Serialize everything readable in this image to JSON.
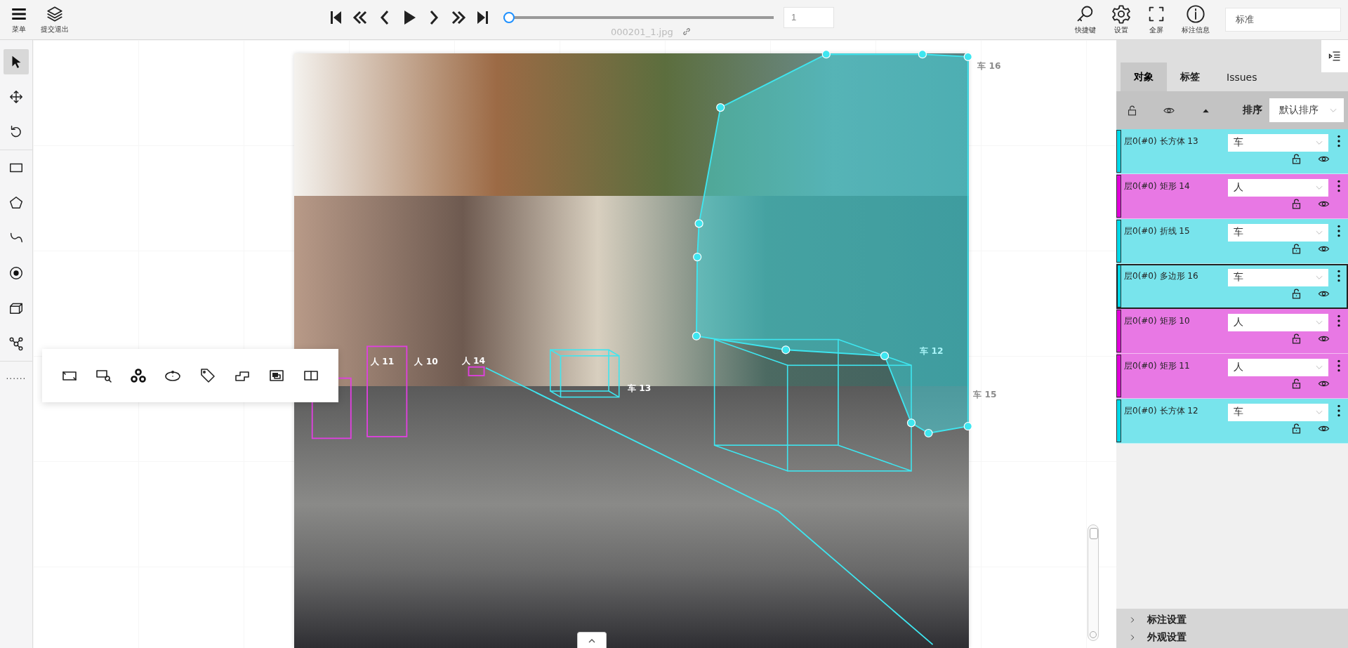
{
  "toolbar": {
    "left_buttons": [
      {
        "kind": "menu",
        "label": "菜单"
      },
      {
        "kind": "submit",
        "label": "提交退出"
      }
    ],
    "playback": [
      {
        "kind": "first"
      },
      {
        "kind": "fast-back"
      },
      {
        "kind": "back"
      },
      {
        "kind": "play"
      },
      {
        "kind": "forward"
      },
      {
        "kind": "fast-forward"
      },
      {
        "kind": "last"
      }
    ],
    "frame_slider": {
      "level": 0
    },
    "frame_input": {
      "value": "1"
    },
    "file_name": "000201_1.jpg",
    "right_buttons": [
      {
        "kind": "shortcuts",
        "label": "快捷键"
      },
      {
        "kind": "settings",
        "label": "设置"
      },
      {
        "kind": "fullscreen",
        "label": "全屏"
      },
      {
        "kind": "info",
        "label": "标注信息"
      }
    ],
    "search": {
      "value": "标准"
    }
  },
  "tools": [
    {
      "kind": "select",
      "selected": true
    },
    {
      "kind": "move",
      "selected": false
    },
    {
      "kind": "rotate",
      "selected": false
    },
    {
      "kind": "rect",
      "selected": false
    },
    {
      "kind": "polygon",
      "selected": false
    },
    {
      "kind": "curve",
      "selected": false
    },
    {
      "kind": "point",
      "selected": false
    },
    {
      "kind": "cuboid",
      "selected": false
    },
    {
      "kind": "keypoints",
      "selected": false
    }
  ],
  "more_tools": "......",
  "popup_tools": [
    {
      "kind": "skew-rect"
    },
    {
      "kind": "zoom-rect"
    },
    {
      "kind": "rings"
    },
    {
      "kind": "ellipse"
    },
    {
      "kind": "tag"
    },
    {
      "kind": "steps"
    },
    {
      "kind": "frames"
    },
    {
      "kind": "split"
    }
  ],
  "annotations": [
    {
      "kind": "rect",
      "label": "人 11",
      "color": "#e040e0"
    },
    {
      "kind": "rect",
      "label": "人 10",
      "color": "#e040e0"
    },
    {
      "kind": "rect",
      "label": "人 14",
      "color": "#e040e0"
    },
    {
      "kind": "cuboid",
      "label": "车 13",
      "color": "#3ee6f0"
    },
    {
      "kind": "cuboid",
      "label": "车 12",
      "color": "#3ee6f0"
    },
    {
      "kind": "polyline",
      "label": "车 15",
      "color": "#3ee6f0"
    },
    {
      "kind": "polygon",
      "label": "车 16",
      "color": "#3ee6f0"
    }
  ],
  "zoom_slider": {
    "level": 1
  },
  "panel": {
    "tabs": [
      {
        "label": "对象",
        "selected": true
      },
      {
        "label": "标签",
        "selected": false
      },
      {
        "label": "Issues",
        "selected": false
      }
    ],
    "sort_label": "排序",
    "sort_value": "默认排序",
    "objects": [
      {
        "name": "层0(#0) 长方体 13",
        "category": "车",
        "color": "#00d8e8",
        "selected": false
      },
      {
        "name": "层0(#0) 矩形 14",
        "category": "人",
        "color": "#e000d8",
        "selected": false
      },
      {
        "name": "层0(#0) 折线 15",
        "category": "车",
        "color": "#00d8e8",
        "selected": false
      },
      {
        "name": "层0(#0) 多边形 16",
        "category": "车",
        "color": "#00d8e8",
        "selected": true
      },
      {
        "name": "层0(#0) 矩形 10",
        "category": "人",
        "color": "#e000d8",
        "selected": false
      },
      {
        "name": "层0(#0) 矩形 11",
        "category": "人",
        "color": "#e000d8",
        "selected": false
      },
      {
        "name": "层0(#0) 长方体 12",
        "category": "车",
        "color": "#00d8e8",
        "selected": false
      }
    ],
    "sections": [
      {
        "label": "标注设置",
        "expanded": false
      },
      {
        "label": "外观设置",
        "expanded": false
      }
    ]
  }
}
